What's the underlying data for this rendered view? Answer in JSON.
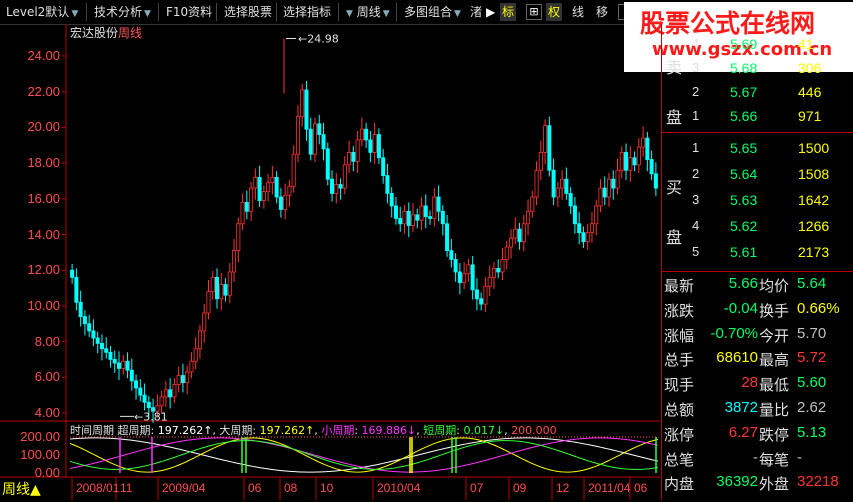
{
  "toolbar": {
    "level2": "Level2默认",
    "tech": "技术分析",
    "f10": "F10资料",
    "select_stock": "选择股票",
    "select_indicator": "选择指标",
    "period": "周线",
    "multi": "多图组合",
    "trunc": "渚",
    "mark": "标",
    "plus": "⊞",
    "rights": "权",
    "line": "线",
    "move": "移"
  },
  "watermark": {
    "line1": "股票公式在线网",
    "line2": "www.gszx.com.cn"
  },
  "stock": {
    "name": "宏达股份",
    "period": "周线"
  },
  "y_axis": [
    "24.00",
    "22.00",
    "20.00",
    "18.00",
    "16.00",
    "14.00",
    "12.00",
    "10.00",
    "8.00",
    "6.00",
    "4.00"
  ],
  "annotations": {
    "high": "24.98",
    "low": "3.81"
  },
  "indicator": {
    "label": "时间周期",
    "super_label": "超周期",
    "super_val": "197.262↑",
    "big_label": "大周期",
    "big_val": "197.262↑",
    "small_label": "小周期",
    "small_val": "169.886↓",
    "short_label": "短周期",
    "short_val": "0.017↓",
    "extra": "200.000",
    "ylabels": [
      "200.00",
      "100.00",
      "0.00"
    ],
    "colors": {
      "super": "#ffffff",
      "big": "#ffff00",
      "small": "#ff33ff",
      "short": "#33ff33",
      "extra": "#ff4d4d"
    }
  },
  "x_axis": [
    "2008/01",
    "11",
    "2009/04",
    "06",
    "08",
    "10",
    "2010/04",
    "07",
    "09",
    "12",
    "2011/04",
    "06"
  ],
  "period_label": "周线",
  "orderbook": {
    "sell_side": "卖盘",
    "buy_side": "买盘",
    "sell": [
      {
        "idx": "4",
        "price": "5.69",
        "vol": "41"
      },
      {
        "idx": "3",
        "price": "5.68",
        "vol": "306"
      },
      {
        "idx": "2",
        "price": "5.67",
        "vol": "446"
      },
      {
        "idx": "1",
        "price": "5.66",
        "vol": "971"
      }
    ],
    "buy": [
      {
        "idx": "1",
        "price": "5.65",
        "vol": "1500"
      },
      {
        "idx": "2",
        "price": "5.64",
        "vol": "1508"
      },
      {
        "idx": "3",
        "price": "5.63",
        "vol": "1642"
      },
      {
        "idx": "4",
        "price": "5.62",
        "vol": "1266"
      },
      {
        "idx": "5",
        "price": "5.61",
        "vol": "2173"
      }
    ]
  },
  "quote": [
    {
      "l1": "最新",
      "v1": "5.66",
      "c1": "#00ff66",
      "l2": "均价",
      "v2": "5.64",
      "c2": "#00ff66"
    },
    {
      "l1": "涨跌",
      "v1": "-0.04",
      "c1": "#00ff66",
      "l2": "换手",
      "v2": "0.66%",
      "c2": "#ffff00"
    },
    {
      "l1": "涨幅",
      "v1": "-0.70%",
      "c1": "#00ff66",
      "l2": "今开",
      "v2": "5.70",
      "c2": "#c0c0c0"
    },
    {
      "l1": "总手",
      "v1": "68610",
      "c1": "#ffff00",
      "l2": "最高",
      "v2": "5.72",
      "c2": "#ff3333"
    },
    {
      "l1": "现手",
      "v1": "28",
      "c1": "#ff3333",
      "l2": "最低",
      "v2": "5.60",
      "c2": "#00ff66"
    },
    {
      "l1": "总额",
      "v1": "3872",
      "c1": "#00ffff",
      "l2": "量比",
      "v2": "2.62",
      "c2": "#c0c0c0"
    },
    {
      "l1": "涨停",
      "v1": "6.27",
      "c1": "#ff3333",
      "l2": "跌停",
      "v2": "5.13",
      "c2": "#00ff66"
    },
    {
      "l1": "总笔",
      "v1": "-",
      "c1": "#c0c0c0",
      "l2": "每笔",
      "v2": "-",
      "c2": "#c0c0c0"
    },
    {
      "l1": "内盘",
      "v1": "36392",
      "c1": "#00ff66",
      "l2": "外盘",
      "v2": "32218",
      "c2": "#ff3333"
    }
  ],
  "chart_data": {
    "type": "candlestick",
    "ylim": [
      3.5,
      26.0
    ],
    "closes": [
      11.6,
      10.2,
      9.4,
      9.0,
      8.6,
      8.2,
      7.9,
      7.6,
      7.4,
      7.0,
      6.8,
      6.5,
      6.9,
      6.4,
      5.8,
      5.4,
      5.0,
      4.6,
      4.3,
      4.1,
      4.4,
      4.9,
      5.3,
      4.9,
      5.6,
      6.1,
      5.7,
      6.3,
      6.9,
      7.6,
      8.6,
      9.6,
      10.8,
      11.6,
      10.4,
      11.2,
      10.6,
      11.9,
      13.1,
      14.6,
      15.8,
      15.3,
      16.6,
      17.2,
      15.9,
      16.4,
      16.9,
      17.2,
      16.1,
      15.4,
      16.2,
      16.7,
      18.5,
      20.6,
      22.1,
      19.9,
      18.5,
      20.2,
      19.6,
      18.8,
      17.1,
      16.3,
      16.8,
      16.6,
      17.9,
      18.6,
      18.1,
      19.3,
      19.9,
      19.3,
      18.6,
      19.6,
      18.3,
      17.3,
      16.3,
      15.6,
      14.9,
      14.6,
      15.3,
      14.5,
      15.1,
      14.8,
      15.6,
      15.0,
      14.9,
      16.1,
      15.3,
      14.6,
      13.1,
      12.6,
      11.9,
      11.3,
      11.8,
      12.3,
      10.9,
      10.4,
      10.1,
      11.1,
      11.6,
      12.1,
      11.9,
      12.6,
      13.3,
      13.8,
      14.3,
      13.6,
      14.6,
      15.3,
      16.1,
      17.6,
      18.6,
      20.1,
      17.6,
      16.1,
      16.6,
      17.1,
      16.3,
      15.6,
      14.6,
      14.1,
      13.6,
      14.1,
      14.6,
      15.6,
      16.6,
      16.1,
      17.1,
      16.6,
      17.6,
      18.6,
      17.6,
      18.3,
      17.9,
      18.9,
      19.4,
      18.2,
      17.4,
      16.6
    ],
    "high": 24.98,
    "low": 3.81,
    "x_ticks": [
      "2008/01",
      "11",
      "2009/04",
      "06",
      "08",
      "10",
      "2010/04",
      "07",
      "09",
      "12",
      "2011/04",
      "06"
    ]
  }
}
